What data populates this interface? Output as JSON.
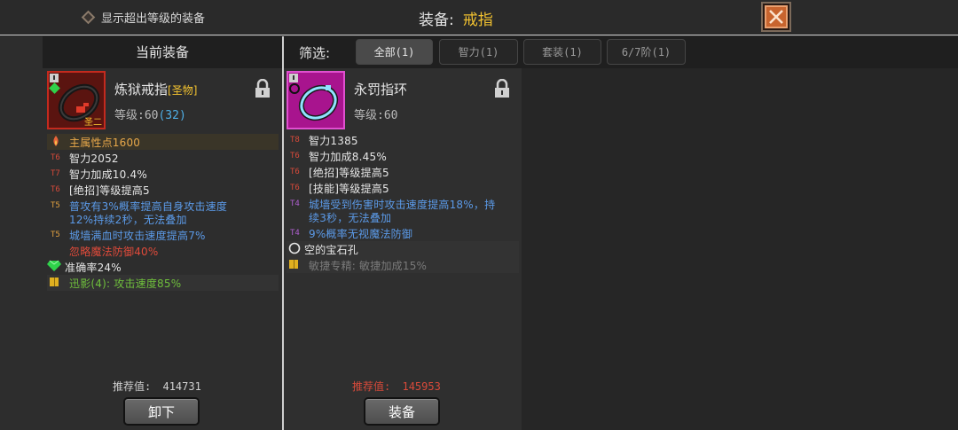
{
  "header": {
    "show_over_label": "显示超出等级的装备",
    "title_label": "装备:",
    "title_value": "戒指"
  },
  "current": {
    "panel_title": "当前装备",
    "item": {
      "name": "炼狱戒指",
      "quality": "[圣物]",
      "level_label": "等级:60",
      "level_bonus": "(32)",
      "icon_badge": "圣二"
    },
    "stats": [
      {
        "tier": "",
        "text": "主属性点1600",
        "color": "#e8a84a",
        "kind": "primary"
      },
      {
        "tier": "T6",
        "text": "智力2052",
        "color": "#e6e6e6"
      },
      {
        "tier": "T7",
        "text": "智力加成10.4%",
        "color": "#e6e6e6"
      },
      {
        "tier": "T6",
        "text": "[绝招]等级提高5",
        "color": "#e6e6e6"
      },
      {
        "tier": "T5",
        "text": "普攻有3%概率提高自身攻击速度",
        "text2": "12%持续2秒，无法叠加",
        "color": "#5b9ae8"
      },
      {
        "tier": "T5",
        "text": "城墙满血时攻击速度提高7%",
        "color": "#5b9ae8"
      },
      {
        "tier": "",
        "text": "忽略魔法防御40%",
        "color": "#e04a3a"
      },
      {
        "tier": "",
        "text": "准确率24%",
        "color": "#e6e6e6",
        "kind": "gem"
      },
      {
        "tier": "",
        "text": "迅影(4): 攻击速度85%",
        "color": "#6fbf3c",
        "kind": "set"
      }
    ],
    "recommend_label": "推荐值:",
    "recommend_value": "414731",
    "action_label": "卸下"
  },
  "filter": {
    "label": "筛选:",
    "tabs": [
      {
        "label": "全部(1)",
        "active": true
      },
      {
        "label": "智力(1)",
        "active": false
      },
      {
        "label": "套装(1)",
        "active": false
      },
      {
        "label": "6/7阶(1)",
        "active": false
      }
    ]
  },
  "candidate": {
    "item": {
      "name": "永罚指环",
      "level_label": "等级:60"
    },
    "stats": [
      {
        "tier": "T8",
        "text": "智力1385",
        "color": "#e6e6e6"
      },
      {
        "tier": "T6",
        "text": "智力加成8.45%",
        "color": "#e6e6e6"
      },
      {
        "tier": "T6",
        "text": "[绝招]等级提高5",
        "color": "#e6e6e6"
      },
      {
        "tier": "T6",
        "text": "[技能]等级提高5",
        "color": "#e6e6e6"
      },
      {
        "tier": "T4",
        "text": "城墙受到伤害时攻击速度提高18%，持",
        "text2": "续3秒，无法叠加",
        "color": "#5b9ae8"
      },
      {
        "tier": "T4",
        "text": "9%概率无视魔法防御",
        "color": "#5b9ae8"
      },
      {
        "tier": "",
        "text": "空的宝石孔",
        "color": "#e6e6e6",
        "kind": "socket"
      },
      {
        "tier": "",
        "text": "敏捷专精: 敏捷加成15%",
        "color": "#7a7a7a",
        "kind": "set"
      }
    ],
    "recommend_label": "推荐值:",
    "recommend_value": "145953",
    "action_label": "装备"
  },
  "colors": {
    "tier_red": "#d84a3a",
    "tier_orange": "#e0a040",
    "tier_purple": "#b060d0",
    "legendary_frame": "#b8281e",
    "epic_frame": "#d040c0",
    "title_gold": "#f2c230",
    "recommend_red": "#d84a3a"
  }
}
